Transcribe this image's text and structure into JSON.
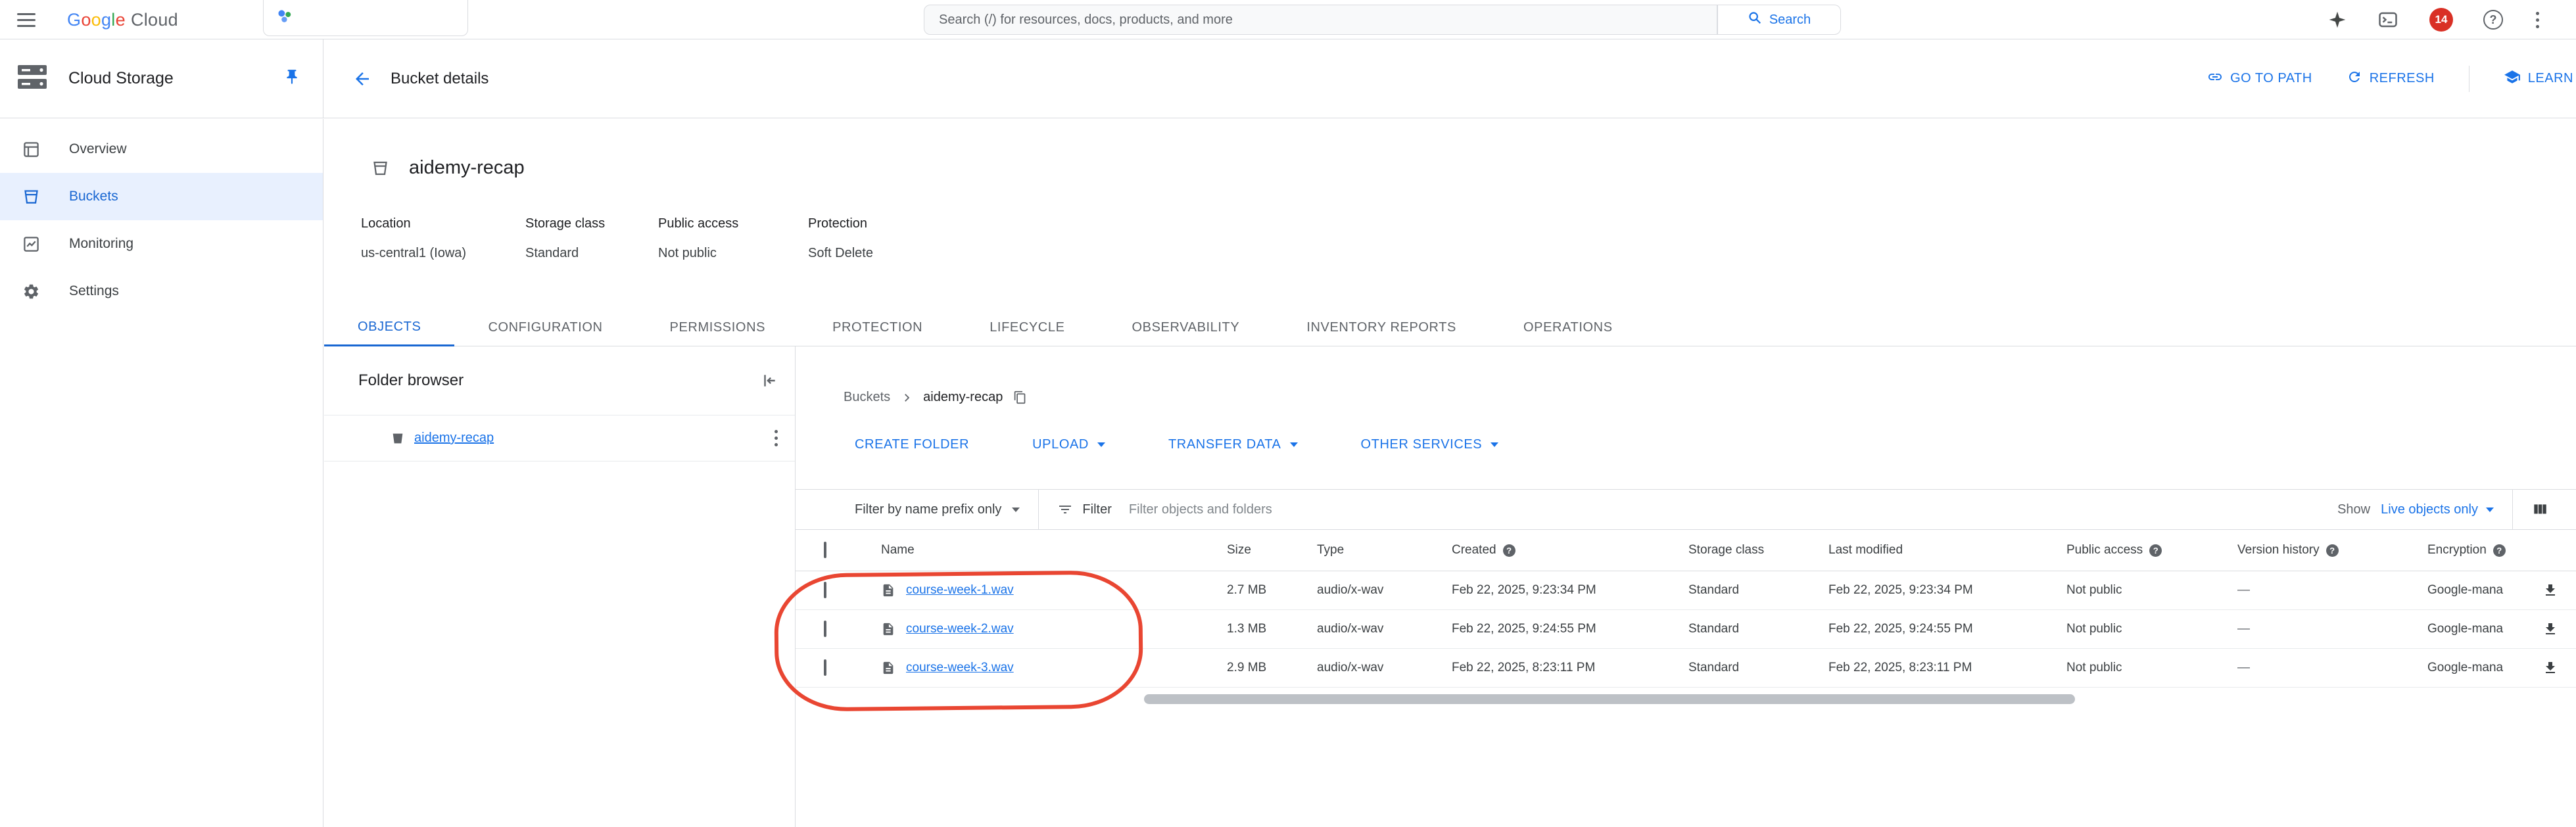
{
  "topbar": {
    "logo": {
      "letters": [
        {
          "ch": "G",
          "color": "#4285F4"
        },
        {
          "ch": "o",
          "color": "#EA4335"
        },
        {
          "ch": "o",
          "color": "#FBBC04"
        },
        {
          "ch": "g",
          "color": "#4285F4"
        },
        {
          "ch": "l",
          "color": "#34A853"
        },
        {
          "ch": "e",
          "color": "#EA4335"
        }
      ],
      "suffix": "Cloud"
    },
    "search_placeholder": "Search (/) for resources, docs, products, and more",
    "search_button": "Search",
    "notification_count": "14"
  },
  "appbar": {
    "product": "Cloud Storage",
    "page_title": "Bucket details",
    "actions": {
      "go_to_path": "GO TO PATH",
      "refresh": "REFRESH",
      "learn": "LEARN"
    }
  },
  "sidebar": {
    "items": [
      {
        "label": "Overview"
      },
      {
        "label": "Buckets"
      },
      {
        "label": "Monitoring"
      },
      {
        "label": "Settings"
      }
    ]
  },
  "bucket": {
    "name": "aidemy-recap",
    "meta": [
      {
        "label": "Location",
        "value": "us-central1 (Iowa)"
      },
      {
        "label": "Storage class",
        "value": "Standard"
      },
      {
        "label": "Public access",
        "value": "Not public"
      },
      {
        "label": "Protection",
        "value": "Soft Delete"
      }
    ]
  },
  "tabs": [
    {
      "label": "OBJECTS"
    },
    {
      "label": "CONFIGURATION"
    },
    {
      "label": "PERMISSIONS"
    },
    {
      "label": "PROTECTION"
    },
    {
      "label": "LIFECYCLE"
    },
    {
      "label": "OBSERVABILITY"
    },
    {
      "label": "INVENTORY REPORTS"
    },
    {
      "label": "OPERATIONS"
    }
  ],
  "folder_browser": {
    "title": "Folder browser",
    "item": "aidemy-recap"
  },
  "objects": {
    "breadcrumb": {
      "root": "Buckets",
      "current": "aidemy-recap"
    },
    "buttons": {
      "create_folder": "CREATE FOLDER",
      "upload": "UPLOAD",
      "transfer": "TRANSFER DATA",
      "other": "OTHER SERVICES"
    },
    "filter": {
      "prefix_dropdown": "Filter by name prefix only",
      "filter_label": "Filter",
      "placeholder": "Filter objects and folders",
      "show_label": "Show",
      "show_value": "Live objects only"
    },
    "table": {
      "headers": {
        "name": "Name",
        "size": "Size",
        "type": "Type",
        "created": "Created",
        "storage_class": "Storage class",
        "last_modified": "Last modified",
        "public_access": "Public access",
        "version_history": "Version history",
        "encryption": "Encryption"
      },
      "rows": [
        {
          "name": "course-week-1.wav",
          "size": "2.7 MB",
          "type": "audio/x-wav",
          "created": "Feb 22, 2025, 9:23:34 PM",
          "storage_class": "Standard",
          "last_modified": "Feb 22, 2025, 9:23:34 PM",
          "public_access": "Not public",
          "version_history": "—",
          "encryption": "Google-mana"
        },
        {
          "name": "course-week-2.wav",
          "size": "1.3 MB",
          "type": "audio/x-wav",
          "created": "Feb 22, 2025, 9:24:55 PM",
          "storage_class": "Standard",
          "last_modified": "Feb 22, 2025, 9:24:55 PM",
          "public_access": "Not public",
          "version_history": "—",
          "encryption": "Google-mana"
        },
        {
          "name": "course-week-3.wav",
          "size": "2.9 MB",
          "type": "audio/x-wav",
          "created": "Feb 22, 2025, 8:23:11 PM",
          "storage_class": "Standard",
          "last_modified": "Feb 22, 2025, 8:23:11 PM",
          "public_access": "Not public",
          "version_history": "—",
          "encryption": "Google-mana"
        }
      ]
    }
  },
  "colors": {
    "accent": "#1a73e8",
    "selected_nav_bg": "#e8f0fe",
    "selected_nav_text": "#1967d2",
    "badge_red": "#d93025",
    "annotation_red": "#e94632",
    "border": "#dadce0"
  }
}
